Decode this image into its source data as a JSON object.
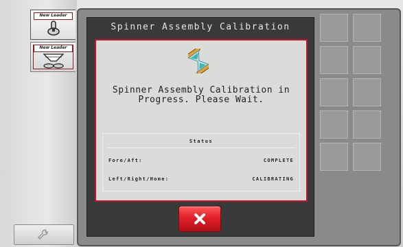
{
  "dialog": {
    "title": "Spinner Assembly Calibration",
    "message_line1": "Spinner Assembly Calibration in",
    "message_line2": "Progress. Please Wait.",
    "hourglass_icon": "hourglass-icon",
    "cancel_icon": "close-icon"
  },
  "status": {
    "heading": "Status",
    "rows": [
      {
        "label": "Fore/Aft:",
        "value": "COMPLETE"
      },
      {
        "label": "Left/Right/Home:",
        "value": "CALIBRATING"
      }
    ]
  },
  "sidebar": {
    "tabs": [
      {
        "brand": "New Leader",
        "icon": "joystick-icon"
      },
      {
        "brand": "New Leader",
        "icon": "spinner-hopper-icon"
      }
    ],
    "tools_icon": "wrench-icon"
  },
  "colors": {
    "accent_red": "#c2142c",
    "dialog_dark": "#3a3a3a",
    "panel_bg": "#d9dcd9"
  }
}
